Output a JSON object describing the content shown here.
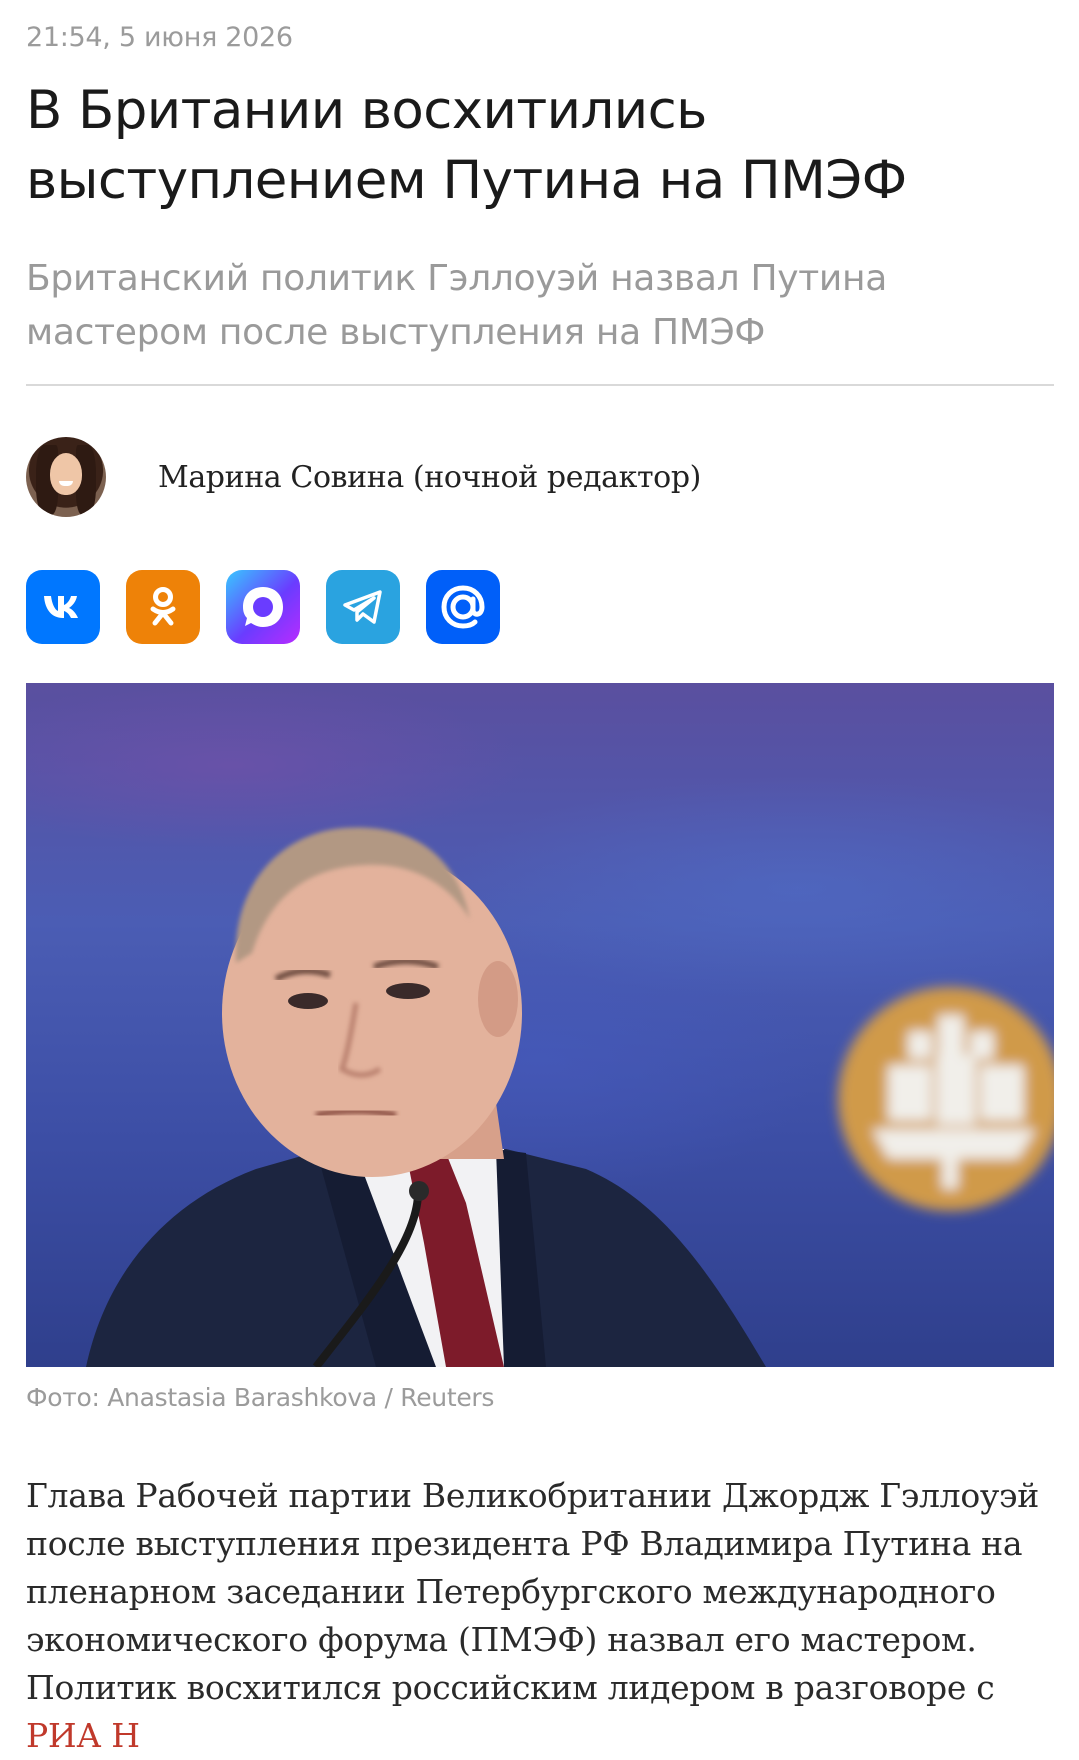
{
  "article": {
    "timestamp": "21:54, 5 июня 2026",
    "headline": "В Британии восхитились выступлением Путина на ПМЭФ",
    "subtitle": "Британский политик Гэллоуэй назвал Путина мастером после выступления на ПМЭФ",
    "author": {
      "name": "Марина Совина (ночной редактор)"
    },
    "share_buttons": [
      {
        "network": "vk",
        "icon": "vk-icon",
        "color": "#0077ff"
      },
      {
        "network": "odnoklassniki",
        "icon": "ok-icon",
        "color": "#ee8208"
      },
      {
        "network": "max",
        "icon": "max-messenger-icon",
        "color": "#5c3cff"
      },
      {
        "network": "telegram",
        "icon": "telegram-icon",
        "color": "#2aa3e0"
      },
      {
        "network": "mail",
        "icon": "at-sign-icon",
        "color": "#005ff9"
      }
    ],
    "photo_caption": "Фото: Anastasia Barashkova / Reuters",
    "body_text": "Глава Рабочей партии Великобритании Джордж Гэллоуэй после выступления президента РФ Владимира Путина на пленарном заседании Петербургского международного экономического форума (ПМЭФ) назвал его мастером. Политик восхитился российским лидером в разговоре с",
    "body_link": "РИА Н"
  }
}
